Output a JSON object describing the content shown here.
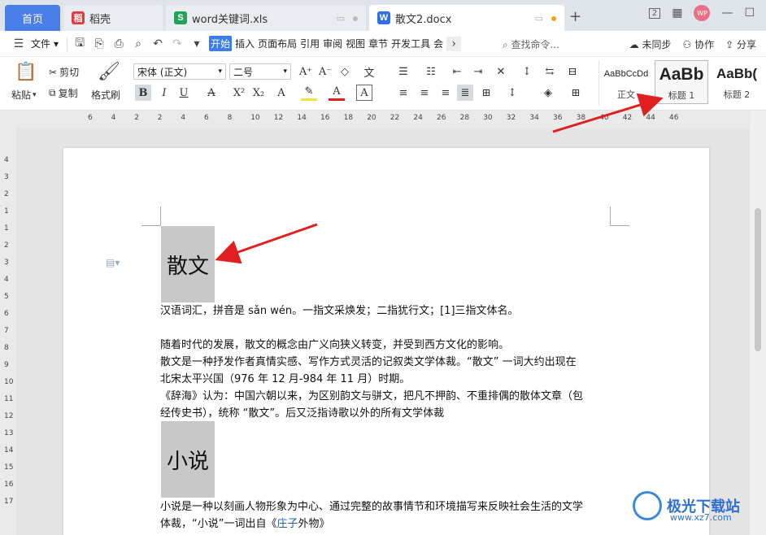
{
  "tabs": {
    "home": "首页",
    "daoke": "稻壳",
    "xls": "word关键词.xls",
    "docx": "散文2.docx",
    "new_tab": "+"
  },
  "tab_icons": {
    "daoke": "稻",
    "xls": "S",
    "docx": "W"
  },
  "window": {
    "avatar": "WP",
    "layout_num": "2"
  },
  "menu": {
    "file": "文件",
    "tabs": [
      "开始",
      "插入",
      "页面布局",
      "引用",
      "审阅",
      "视图",
      "章节",
      "开发工具",
      "会"
    ],
    "search": "查找命令...",
    "unsynced": "未同步",
    "collab": "协作",
    "share": "分享"
  },
  "ribbon": {
    "paste": "粘贴",
    "cut": "剪切",
    "copy": "复制",
    "format_painter": "格式刷",
    "font_name": "宋体 (正文)",
    "font_size": "二号",
    "styles": [
      {
        "preview": "AaBbCcDd",
        "label": "正文"
      },
      {
        "preview": "AaBb",
        "label": "标题 1"
      },
      {
        "preview": "AaBb(",
        "label": "标题 2"
      }
    ]
  },
  "ruler": {
    "h_ticks": [
      "6",
      "4",
      "2",
      "2",
      "4",
      "6",
      "8",
      "10",
      "12",
      "14",
      "16",
      "18",
      "20",
      "22",
      "24",
      "26",
      "28",
      "30",
      "32",
      "34",
      "36",
      "38",
      "40",
      "42",
      "44",
      "46"
    ],
    "v_ticks": [
      "4",
      "3",
      "2",
      "1",
      "1",
      "2",
      "3",
      "4",
      "5",
      "6",
      "7",
      "8",
      "9",
      "10",
      "11",
      "12",
      "13",
      "14",
      "15",
      "16",
      "17"
    ]
  },
  "document": {
    "heading1": "散文",
    "p1": "汉语词汇，拼音是 sǎn wén。一指文采焕发；二指犹行文；[1]三指文体名。",
    "p2": "随着时代的发展，散文的概念由广义向狭义转变，并受到西方文化的影响。",
    "p3a": "散文是一种抒发作者真情实感、写作方式灵活的记叙类文学体裁。“散文” 一词大约出现在",
    "p3b": "北宋太平兴国（976 年 12 月-984 年 11 月）时期。",
    "p4a": "《辞海》认为：中国六朝以来，为区别韵文与骈文，把凡不押韵、不重排偶的散体文章（包",
    "p4b": "经传史书），统称 “散文”。后又泛指诗歌以外的所有文学体裁",
    "heading2": "小说",
    "p5a": "小说是一种以刻画人物形象为中心、通过完整的故事情节和环境描写来反映社会生活的文学",
    "p5b_pre": "体裁，“小说”一词出自《",
    "p5b_link": "庄子",
    "p5b_post": "外物》"
  },
  "watermark": {
    "name": "极光下载站",
    "url": "www.xz7.com"
  },
  "colors": {
    "accent": "#3b7de8",
    "arrow": "#e02020",
    "heading_bg": "#c8c8c8"
  }
}
